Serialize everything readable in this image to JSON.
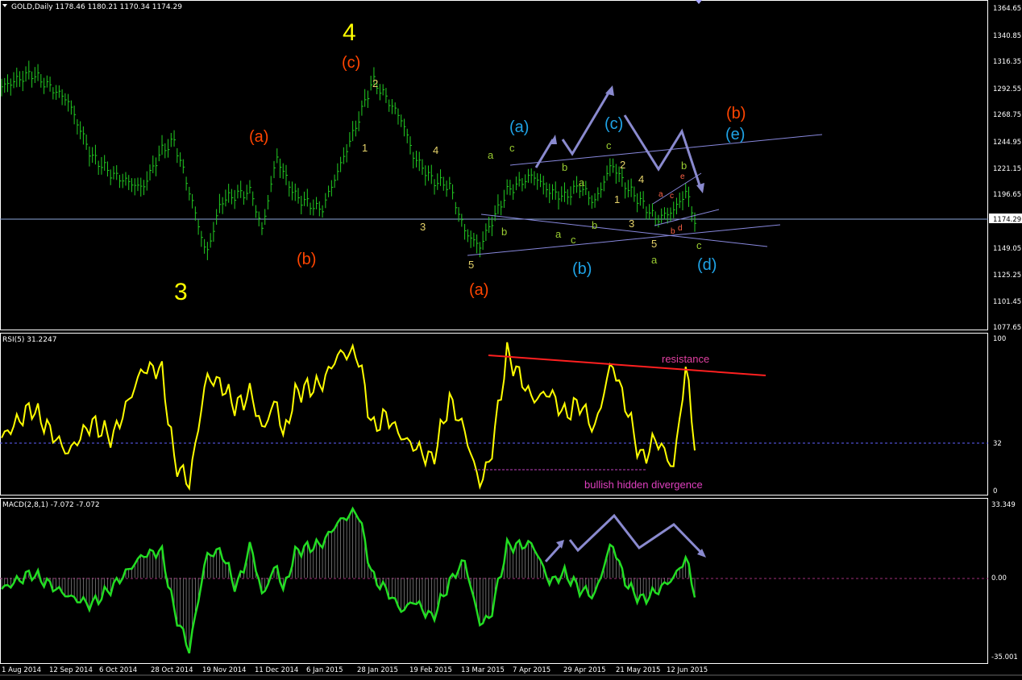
{
  "price_panel": {
    "header": "GOLD,Daily  1178.46 1180.21 1170.34 1174.29",
    "current_price": "1174.29",
    "y_ticks": [
      "1364.65",
      "1340.85",
      "1316.35",
      "1292.55",
      "1268.75",
      "1244.95",
      "1221.15",
      "1196.65",
      "1174.29",
      "1149.05",
      "1125.25",
      "1101.45",
      "1077.65"
    ]
  },
  "rsi_panel": {
    "header": "RSI(5) 31.2247",
    "y_ticks": [
      "100",
      "32",
      "0"
    ],
    "resistance_label": "resistance",
    "divergence_label": "bullish hidden divergence"
  },
  "macd_panel": {
    "header": "MACD(2,8,1) -7.072 -7.072",
    "y_ticks": [
      "33.349",
      "0.00",
      "-35.001"
    ]
  },
  "x_ticks": [
    "1 Aug 2014",
    "12 Sep 2014",
    "6 Oct 2014",
    "28 Oct 2014",
    "19 Nov 2014",
    "11 Dec 2014",
    "6 Jan 2015",
    "28 Jan 2015",
    "19 Feb 2015",
    "13 Mar 2015",
    "7 Apr 2015",
    "29 Apr 2015",
    "21 May 2015",
    "12 Jun 2015"
  ],
  "wave_labels": [
    {
      "id": "w4",
      "text": "4",
      "color": "#ffff00"
    },
    {
      "id": "wc_main",
      "text": "(c)",
      "color": "#ff4500"
    },
    {
      "id": "w2a",
      "text": "2",
      "color": "#e6d36a"
    },
    {
      "id": "w1a",
      "text": "1",
      "color": "#e6d36a"
    },
    {
      "id": "wa_left",
      "text": "(a)",
      "color": "#ff4500"
    },
    {
      "id": "wb_left",
      "text": "(b)",
      "color": "#ff4500"
    },
    {
      "id": "w3_big",
      "text": "3",
      "color": "#ffff00"
    },
    {
      "id": "w4s",
      "text": "4",
      "color": "#e6d36a"
    },
    {
      "id": "w3s",
      "text": "3",
      "color": "#e6d36a"
    },
    {
      "id": "w5s",
      "text": "5",
      "color": "#e6d36a"
    },
    {
      "id": "wa_low",
      "text": "(a)",
      "color": "#ff4500"
    },
    {
      "id": "wa_blue",
      "text": "(a)",
      "color": "#1fa3e6"
    },
    {
      "id": "wc_blue",
      "text": "(c)",
      "color": "#1fa3e6"
    },
    {
      "id": "wb_right",
      "text": "(b)",
      "color": "#ff4500"
    },
    {
      "id": "we_blue",
      "text": "(e)",
      "color": "#1fa3e6"
    },
    {
      "id": "wb_blue",
      "text": "(b)",
      "color": "#1fa3e6"
    },
    {
      "id": "wd_blue",
      "text": "(d)",
      "color": "#1fa3e6"
    },
    {
      "id": "s_a1",
      "text": "a",
      "color": "#9acd32"
    },
    {
      "id": "s_c1",
      "text": "c",
      "color": "#9acd32"
    },
    {
      "id": "s_b1",
      "text": "b",
      "color": "#9acd32"
    },
    {
      "id": "s_b2",
      "text": "b",
      "color": "#9acd32"
    },
    {
      "id": "s_a2",
      "text": "a",
      "color": "#9acd32"
    },
    {
      "id": "s_a3",
      "text": "a",
      "color": "#9acd32"
    },
    {
      "id": "s_c2",
      "text": "c",
      "color": "#9acd32"
    },
    {
      "id": "s_b3",
      "text": "b",
      "color": "#9acd32"
    },
    {
      "id": "s_c3",
      "text": "c",
      "color": "#9acd32"
    },
    {
      "id": "w2b",
      "text": "2",
      "color": "#e6d36a"
    },
    {
      "id": "w4b",
      "text": "4",
      "color": "#e6d36a"
    },
    {
      "id": "w1b",
      "text": "1",
      "color": "#e6d36a"
    },
    {
      "id": "w3b",
      "text": "3",
      "color": "#e6d36a"
    },
    {
      "id": "w5b",
      "text": "5",
      "color": "#e6d36a"
    },
    {
      "id": "s_a4",
      "text": "a",
      "color": "#9acd32"
    },
    {
      "id": "s_b4",
      "text": "b",
      "color": "#9acd32"
    },
    {
      "id": "s_c4",
      "text": "c",
      "color": "#9acd32"
    },
    {
      "id": "o_a",
      "text": "a",
      "color": "#ff6347"
    },
    {
      "id": "o_c",
      "text": "c",
      "color": "#ff6347"
    },
    {
      "id": "o_e",
      "text": "e",
      "color": "#ff6347"
    },
    {
      "id": "o_b",
      "text": "b",
      "color": "#ff6347"
    },
    {
      "id": "o_d",
      "text": "d",
      "color": "#ff6347"
    }
  ],
  "chart_data": {
    "type": "line",
    "title": "GOLD,Daily",
    "series": [
      {
        "name": "GOLD,Daily",
        "x": [
          "2014-08-01",
          "2014-08-15",
          "2014-09-01",
          "2014-09-12",
          "2014-09-22",
          "2014-10-06",
          "2014-10-15",
          "2014-10-21",
          "2014-10-28",
          "2014-11-05",
          "2014-11-12",
          "2014-11-19",
          "2014-11-26",
          "2014-12-01",
          "2014-12-08",
          "2014-12-11",
          "2014-12-17",
          "2014-12-29",
          "2015-01-06",
          "2015-01-15",
          "2015-01-22",
          "2015-01-28",
          "2015-02-05",
          "2015-02-10",
          "2015-02-19",
          "2015-02-27",
          "2015-03-06",
          "2015-03-13",
          "2015-03-18",
          "2015-03-26",
          "2015-04-07",
          "2015-04-15",
          "2015-04-22",
          "2015-04-29",
          "2015-05-06",
          "2015-05-14",
          "2015-05-21",
          "2015-05-28",
          "2015-06-04",
          "2015-06-12",
          "2015-06-18",
          "2015-06-22"
        ],
        "values": [
          1294,
          1306,
          1282,
          1232,
          1215,
          1203,
          1237,
          1245,
          1200,
          1143,
          1192,
          1197,
          1200,
          1165,
          1232,
          1217,
          1195,
          1183,
          1220,
          1263,
          1300,
          1285,
          1263,
          1232,
          1210,
          1205,
          1165,
          1150,
          1170,
          1200,
          1215,
          1200,
          1195,
          1205,
          1190,
          1225,
          1204,
          1190,
          1175,
          1183,
          1200,
          1174
        ]
      },
      {
        "name": "RSI(5)",
        "x": [
          "2014-08-01",
          "2014-08-15",
          "2014-09-01",
          "2014-09-12",
          "2014-09-22",
          "2014-10-06",
          "2014-10-15",
          "2014-10-21",
          "2014-10-28",
          "2014-11-05",
          "2014-11-12",
          "2014-11-19",
          "2014-11-26",
          "2014-12-01",
          "2014-12-08",
          "2014-12-11",
          "2014-12-17",
          "2014-12-29",
          "2015-01-06",
          "2015-01-15",
          "2015-01-22",
          "2015-01-28",
          "2015-02-05",
          "2015-02-10",
          "2015-02-19",
          "2015-02-27",
          "2015-03-06",
          "2015-03-13",
          "2015-03-18",
          "2015-03-26",
          "2015-04-07",
          "2015-04-15",
          "2015-04-22",
          "2015-04-29",
          "2015-05-06",
          "2015-05-14",
          "2015-05-21",
          "2015-05-28",
          "2015-06-04",
          "2015-06-12",
          "2015-06-18",
          "2015-06-22"
        ],
        "values": [
          35,
          55,
          25,
          45,
          35,
          80,
          80,
          20,
          5,
          75,
          70,
          55,
          65,
          40,
          60,
          35,
          65,
          70,
          90,
          90,
          40,
          50,
          35,
          30,
          20,
          60,
          40,
          5,
          20,
          90,
          60,
          65,
          50,
          58,
          40,
          85,
          55,
          20,
          35,
          15,
          83,
          31
        ]
      },
      {
        "name": "MACD(2,8,1)",
        "x": [
          "2014-08-01",
          "2014-08-15",
          "2014-09-01",
          "2014-09-12",
          "2014-09-22",
          "2014-10-06",
          "2014-10-15",
          "2014-10-21",
          "2014-10-28",
          "2014-11-05",
          "2014-11-12",
          "2014-11-19",
          "2014-11-26",
          "2014-12-01",
          "2014-12-08",
          "2014-12-11",
          "2014-12-17",
          "2014-12-29",
          "2015-01-06",
          "2015-01-15",
          "2015-01-22",
          "2015-01-28",
          "2015-02-05",
          "2015-02-10",
          "2015-02-19",
          "2015-02-27",
          "2015-03-06",
          "2015-03-13",
          "2015-03-18",
          "2015-03-26",
          "2015-04-07",
          "2015-04-15",
          "2015-04-22",
          "2015-04-29",
          "2015-05-06",
          "2015-05-14",
          "2015-05-21",
          "2015-05-28",
          "2015-06-04",
          "2015-06-12",
          "2015-06-18",
          "2015-06-22"
        ],
        "values": [
          -5,
          2,
          -8,
          -12,
          -4,
          10,
          12,
          -15,
          -32,
          10,
          12,
          -5,
          15,
          -8,
          6,
          -6,
          12,
          15,
          25,
          30,
          0,
          -5,
          -15,
          -10,
          -18,
          -2,
          8,
          -20,
          -18,
          14,
          15,
          -2,
          2,
          -5,
          -8,
          16,
          -3,
          -10,
          -6,
          0,
          9,
          -7
        ]
      }
    ],
    "ylim_price": [
      1077.65,
      1364.65
    ],
    "ylim_rsi": [
      0,
      100
    ],
    "ylim_macd": [
      -35.001,
      33.349
    ],
    "horizontal_levels": {
      "price": 1174.29,
      "rsi": 32,
      "macd": 0
    }
  }
}
